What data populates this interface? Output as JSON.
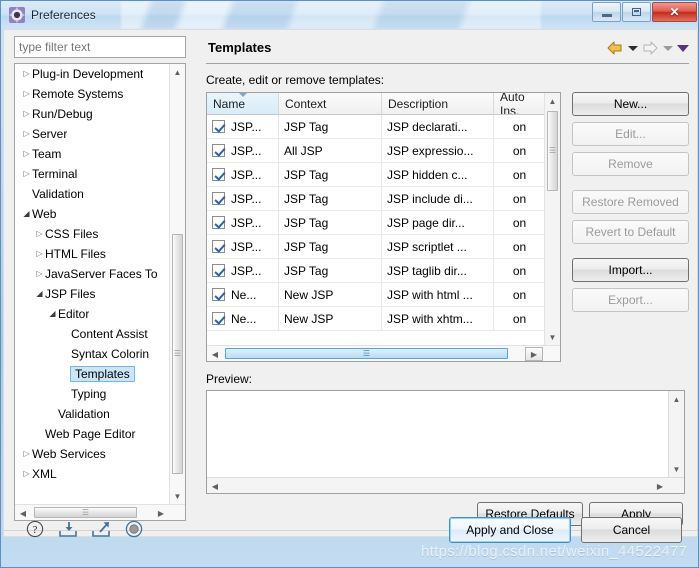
{
  "window": {
    "title": "Preferences",
    "icon": "eclipse-preferences-icon",
    "controls": {
      "minimize": "minimize-button",
      "restore": "restore-button",
      "close": "✕"
    }
  },
  "sidebar": {
    "filter_placeholder": "type filter text",
    "filter_value": "",
    "items": [
      {
        "label": "Plug-in Development",
        "indent": 0,
        "state": "collapsed"
      },
      {
        "label": "Remote Systems",
        "indent": 0,
        "state": "collapsed"
      },
      {
        "label": "Run/Debug",
        "indent": 0,
        "state": "collapsed"
      },
      {
        "label": "Server",
        "indent": 0,
        "state": "collapsed"
      },
      {
        "label": "Team",
        "indent": 0,
        "state": "collapsed"
      },
      {
        "label": "Terminal",
        "indent": 0,
        "state": "collapsed"
      },
      {
        "label": "Validation",
        "indent": 0,
        "state": "leaf"
      },
      {
        "label": "Web",
        "indent": 0,
        "state": "expanded"
      },
      {
        "label": "CSS Files",
        "indent": 1,
        "state": "collapsed"
      },
      {
        "label": "HTML Files",
        "indent": 1,
        "state": "collapsed"
      },
      {
        "label": "JavaServer Faces To",
        "indent": 1,
        "state": "collapsed"
      },
      {
        "label": "JSP Files",
        "indent": 1,
        "state": "expanded"
      },
      {
        "label": "Editor",
        "indent": 2,
        "state": "expanded"
      },
      {
        "label": "Content Assist",
        "indent": 3,
        "state": "leaf"
      },
      {
        "label": "Syntax Colorin",
        "indent": 3,
        "state": "leaf"
      },
      {
        "label": "Templates",
        "indent": 3,
        "state": "leaf",
        "selected": true
      },
      {
        "label": "Typing",
        "indent": 3,
        "state": "leaf"
      },
      {
        "label": "Validation",
        "indent": 2,
        "state": "leaf"
      },
      {
        "label": "Web Page Editor",
        "indent": 1,
        "state": "leaf"
      },
      {
        "label": "Web Services",
        "indent": 0,
        "state": "collapsed"
      },
      {
        "label": "XML",
        "indent": 0,
        "state": "collapsed"
      }
    ]
  },
  "main": {
    "page_title": "Templates",
    "instruction": "Create, edit or remove templates:",
    "preview_label": "Preview:",
    "preview_value": "",
    "nav": {
      "back": "back-arrow",
      "back_menu": "back-dropdown",
      "forward": "forward-arrow",
      "forward_menu": "forward-dropdown",
      "view_menu": "view-menu-dropdown"
    },
    "table": {
      "columns": [
        "Name",
        "Context",
        "Description",
        "Auto Ins."
      ],
      "sorted_column": "Name",
      "sort_direction": "descending",
      "rows": [
        {
          "checked": true,
          "name": "JSP...",
          "context": "JSP Tag",
          "description": "JSP declarati...",
          "auto": "on"
        },
        {
          "checked": true,
          "name": "JSP...",
          "context": "All JSP",
          "description": "JSP expressio...",
          "auto": "on"
        },
        {
          "checked": true,
          "name": "JSP...",
          "context": "JSP Tag",
          "description": "JSP hidden c...",
          "auto": "on"
        },
        {
          "checked": true,
          "name": "JSP...",
          "context": "JSP Tag",
          "description": "JSP include di...",
          "auto": "on"
        },
        {
          "checked": true,
          "name": "JSP...",
          "context": "JSP Tag",
          "description": "JSP page dir...",
          "auto": "on"
        },
        {
          "checked": true,
          "name": "JSP...",
          "context": "JSP Tag",
          "description": "JSP scriptlet ...",
          "auto": "on"
        },
        {
          "checked": true,
          "name": "JSP...",
          "context": "JSP Tag",
          "description": "JSP taglib dir...",
          "auto": "on"
        },
        {
          "checked": true,
          "name": "Ne...",
          "context": "New JSP",
          "description": "JSP with html ...",
          "auto": "on"
        },
        {
          "checked": true,
          "name": "Ne...",
          "context": "New JSP",
          "description": "JSP with xhtm...",
          "auto": "on"
        }
      ]
    },
    "side_buttons": [
      {
        "label": "New...",
        "enabled": true
      },
      {
        "label": "Edit...",
        "enabled": false
      },
      {
        "label": "Remove",
        "enabled": false
      },
      {
        "label": "Restore Removed",
        "enabled": false
      },
      {
        "label": "Revert to Default",
        "enabled": false
      },
      {
        "label": "Import...",
        "enabled": true
      },
      {
        "label": "Export...",
        "enabled": false
      }
    ],
    "restore_defaults_label": "Restore Defaults",
    "apply_label": "Apply"
  },
  "footer": {
    "icons": [
      "help-icon",
      "import-preferences-icon",
      "export-preferences-icon",
      "record-icon"
    ],
    "apply_and_close_label": "Apply and Close",
    "cancel_label": "Cancel"
  },
  "watermark": "https://blog.csdn.net/weixin_44522477"
}
